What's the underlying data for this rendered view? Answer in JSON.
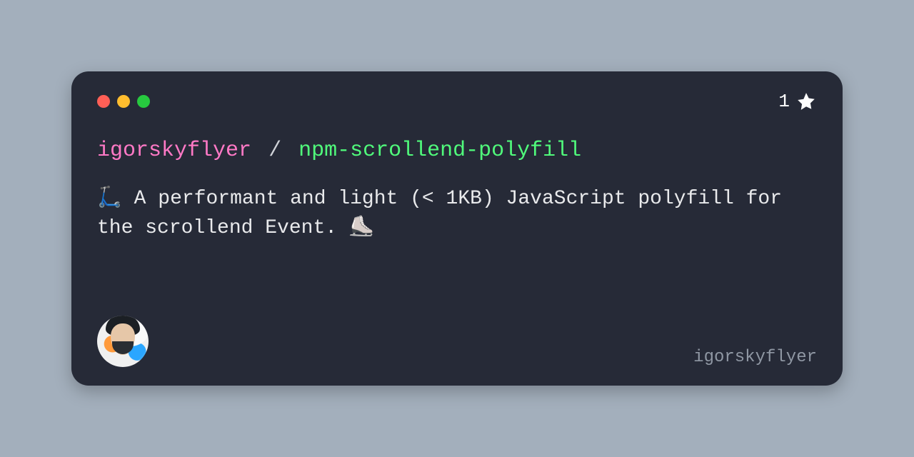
{
  "card": {
    "owner": "igorskyflyer",
    "separator": "/",
    "repo": "npm-scrollend-polyfill",
    "description": "🛴 A performant and light (< 1KB) JavaScript polyfill for the scrollend Event. ⛸️",
    "stars_count": "1",
    "footer_handle": "igorskyflyer"
  },
  "colors": {
    "page_bg": "#a3afbc",
    "card_bg": "#262a37",
    "owner": "#ff79c6",
    "repo": "#50fa7b",
    "text": "#e9eaec",
    "muted": "#8f97a3",
    "traffic_red": "#ff5f56",
    "traffic_yellow": "#ffbd2e",
    "traffic_green": "#27c93f",
    "star": "#ffffff"
  }
}
